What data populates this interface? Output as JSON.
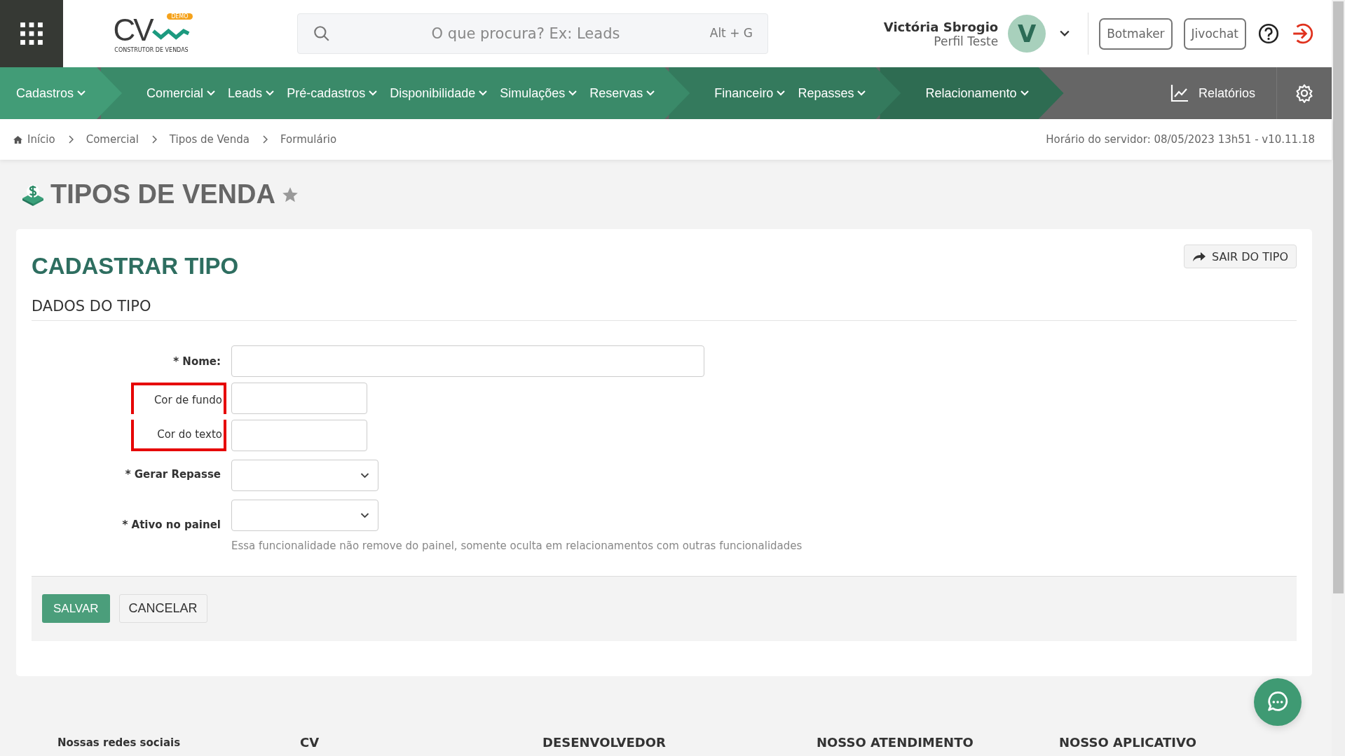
{
  "header": {
    "logo": {
      "mark": "CV",
      "badge": "DEMO",
      "tagline": "CONSTRUTOR DE VENDAS"
    },
    "search": {
      "placeholder": "O que procura? Ex: Leads",
      "shortcut": "Alt + G"
    },
    "user": {
      "name": "Victória Sbrogio",
      "profile": "Perfil Teste",
      "initial": "V"
    },
    "buttons": [
      "Botmaker",
      "Jivochat"
    ]
  },
  "nav": {
    "groups": [
      {
        "color": "#429c77",
        "items": [
          {
            "label": "Cadastros",
            "dropdown": true
          }
        ]
      },
      {
        "color": "#3a8a69",
        "items": [
          {
            "label": "Comercial",
            "dropdown": true
          },
          {
            "label": "Leads",
            "dropdown": true
          },
          {
            "label": "Pré-cadastros",
            "dropdown": true
          },
          {
            "label": "Disponibilidade",
            "dropdown": true
          },
          {
            "label": "Simulações",
            "dropdown": true
          },
          {
            "label": "Reservas",
            "dropdown": true
          }
        ]
      },
      {
        "color": "#347a5d",
        "items": [
          {
            "label": "Financeiro",
            "dropdown": true
          },
          {
            "label": "Repasses",
            "dropdown": true
          }
        ]
      },
      {
        "color": "#2e6c52",
        "items": [
          {
            "label": "Relacionamento",
            "dropdown": true
          }
        ]
      }
    ],
    "reports": "Relatórios"
  },
  "breadcrumb": {
    "items": [
      "Início",
      "Comercial",
      "Tipos de Venda",
      "Formulário"
    ],
    "server_time": "Horário do servidor: 08/05/2023 13h51 - v10.11.18"
  },
  "page_title": "TIPOS DE VENDA",
  "form": {
    "title": "CADASTRAR TIPO",
    "exit_button": "SAIR DO TIPO",
    "section": "DADOS DO TIPO",
    "fields": [
      {
        "label": "* Nome:",
        "kind": "text",
        "required": true,
        "highlighted": false
      },
      {
        "label": "Cor de fundo",
        "kind": "color",
        "required": false,
        "highlighted": true
      },
      {
        "label": "Cor do texto",
        "kind": "color",
        "required": false,
        "highlighted": true
      },
      {
        "label": "* Gerar Repasse",
        "kind": "select",
        "required": true,
        "highlighted": false
      },
      {
        "label": "* Ativo no painel",
        "kind": "select",
        "required": true,
        "highlighted": false,
        "help": "Essa funcionalidade não remove do painel, somente oculta em relacionamentos com outras funcionalidades"
      }
    ],
    "save": "SALVAR",
    "cancel": "CANCELAR"
  },
  "footer": [
    "Nossas redes sociais",
    "CV",
    "DESENVOLVEDOR",
    "NOSSO ATENDIMENTO",
    "NOSSO APLICATIVO"
  ]
}
